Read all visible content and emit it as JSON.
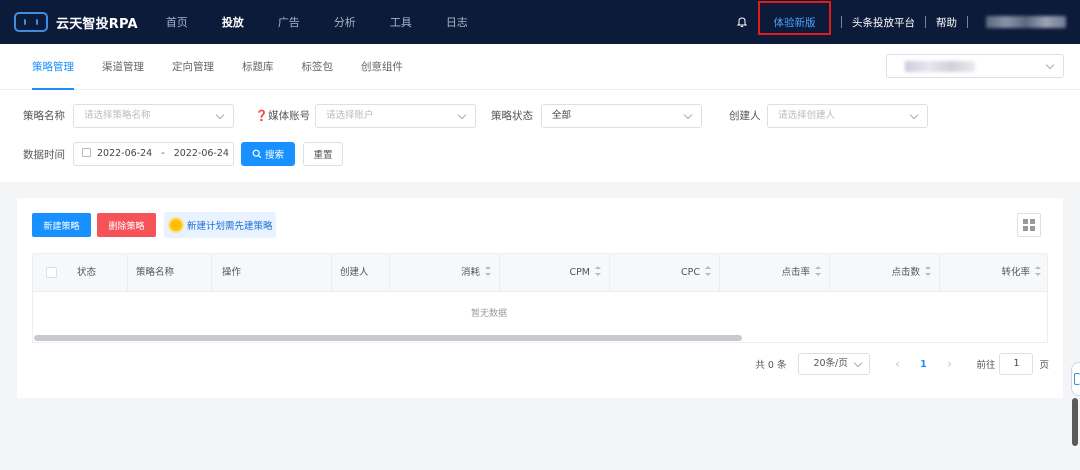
{
  "app": {
    "logo_text": "云天智投RPA"
  },
  "topnav": {
    "items": [
      "首页",
      "投放",
      "广告",
      "分析",
      "工具",
      "日志"
    ],
    "active": "投放",
    "right": {
      "trial_label": "体验新版",
      "platform_label": "头条投放平台",
      "help_label": "帮助"
    }
  },
  "subtabs": {
    "items": [
      "策略管理",
      "渠道管理",
      "定向管理",
      "标题库",
      "标签包",
      "创意组件"
    ],
    "active": "策略管理"
  },
  "filters": {
    "strategy_name_label": "策略名称",
    "strategy_name_placeholder": "请选择策略名称",
    "media_account_label": "❓媒体账号",
    "media_account_placeholder": "请选择账户",
    "strategy_status_label": "策略状态",
    "strategy_status_value": "全部",
    "creator_label": "创建人",
    "creator_placeholder": "请选择创建人",
    "data_time_label": "数据时间",
    "date_start": "2022-06-24",
    "date_sep": "-",
    "date_end": "2022-06-24",
    "search_label": "搜索",
    "reset_label": "重置"
  },
  "toolbar": {
    "new_label": "新建策略",
    "delete_label": "删除策略",
    "tip_label": "新建计划需先建策略"
  },
  "table": {
    "columns": [
      "状态",
      "策略名称",
      "操作",
      "创建人",
      "消耗",
      "CPM",
      "CPC",
      "点击率",
      "点击数",
      "转化率"
    ],
    "empty_text": "暂无数据"
  },
  "pagination": {
    "total_label": "共 0 条",
    "page_size": "20条/页",
    "prev": "‹",
    "current_page": "1",
    "next": "›",
    "goto_label": "前往",
    "goto_value": "1",
    "page_unit": "页"
  },
  "colors": {
    "nav_bg": "#0d1b3a",
    "primary": "#1890ff",
    "danger": "#f5525a",
    "highlight_box": "#e31b1b"
  }
}
